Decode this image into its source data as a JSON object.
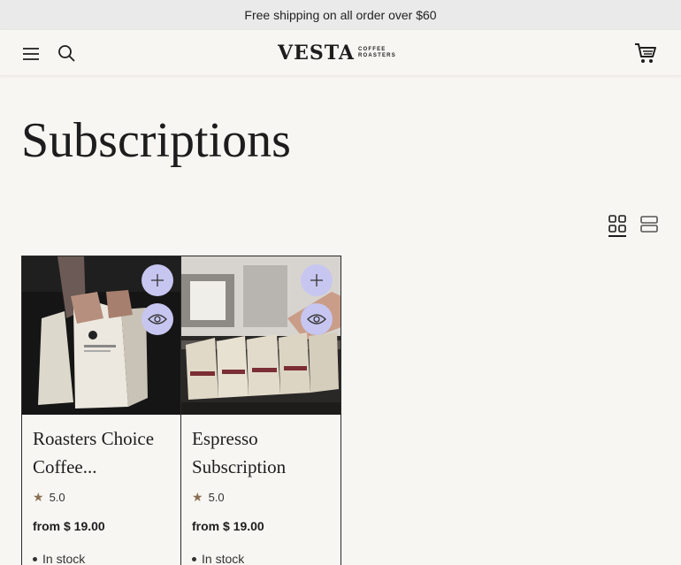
{
  "announcement": "Free shipping on all order over $60",
  "header": {
    "logo_word": "VESTA",
    "logo_sub_1": "COFFEE",
    "logo_sub_2": "ROASTERS",
    "icons": [
      "menu-icon",
      "search-icon",
      "cart-icon"
    ]
  },
  "page": {
    "title": "Subscriptions"
  },
  "view_toggle": [
    "grid-view-icon",
    "list-view-icon"
  ],
  "products": [
    {
      "title": "Roasters Choice Coffee...",
      "rating": "5.0",
      "price": "from $ 19.00",
      "stock": "In stock"
    },
    {
      "title": "Espresso Subscription",
      "rating": "5.0",
      "price": "from $ 19.00",
      "stock": "In stock"
    }
  ],
  "colors": {
    "background": "#f8f6f2",
    "announcement_bg": "#eaeaea",
    "quick_button": "#c7c6f0",
    "star": "#8a6f52"
  }
}
